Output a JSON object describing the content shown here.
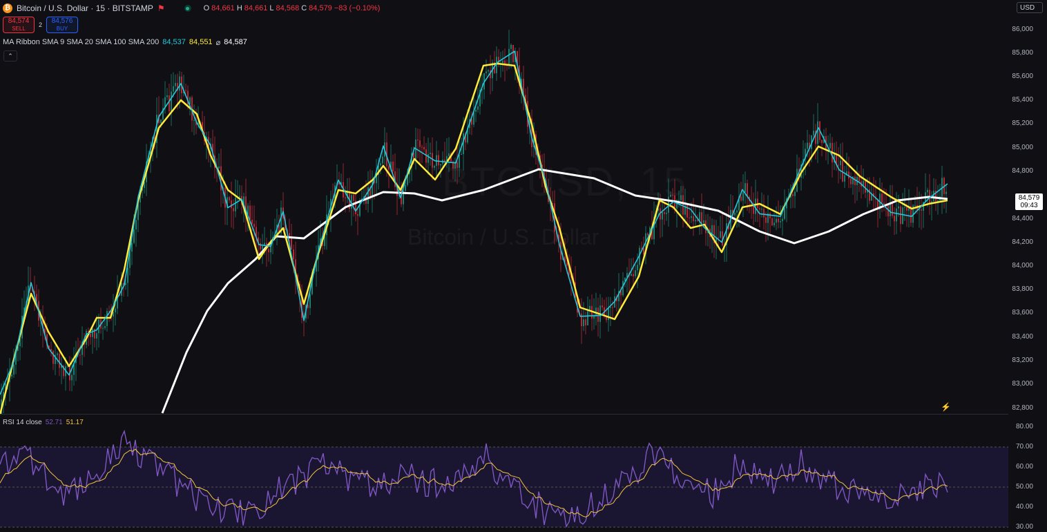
{
  "symbol": {
    "title": "Bitcoin / U.S. Dollar · 15 · BITSTAMP",
    "icon": "bitcoin-icon",
    "ohlc": [
      {
        "k": "O",
        "v": "84,661"
      },
      {
        "k": "H",
        "v": "84,661"
      },
      {
        "k": "L",
        "v": "84,568"
      },
      {
        "k": "C",
        "v": "84,579"
      },
      {
        "k": "",
        "v": "−83 (−0.10%)"
      }
    ]
  },
  "trade": {
    "sell_price": "84,574",
    "sell_label": "SELL",
    "buy_price": "84,576",
    "buy_label": "BUY",
    "spread": "2"
  },
  "ribbon": {
    "label": "MA Ribbon SMA 9 SMA 20 SMA 100 SMA 200",
    "v1": "84,537",
    "v2": "84,551",
    "sep": "⌀",
    "v3": "84,587"
  },
  "currency": "USD",
  "price_axis": [
    "86,000",
    "85,800",
    "85,600",
    "85,400",
    "85,200",
    "85,000",
    "84,800",
    "84,400",
    "84,200",
    "84,000",
    "83,800",
    "83,600",
    "83,400",
    "83,200",
    "83,000",
    "82,800"
  ],
  "last_price": {
    "price": "84,579",
    "countdown": "09:43"
  },
  "rsi": {
    "label": "RSI 14 close",
    "value": "52.71",
    "ma_value": "51.17",
    "axis": [
      "80.00",
      "70.00",
      "60.00",
      "50.00",
      "40.00",
      "30.00"
    ]
  },
  "watermark": {
    "big": "BTCUSD, 15",
    "small": "Bitcoin / U.S. Dollar"
  },
  "colors": {
    "bg": "#0f0f14",
    "up": "#22ab94",
    "down": "#f23645",
    "sma9": "#26c6da",
    "sma20": "#ffeb3b",
    "sma200": "#ffffff",
    "rsi": "#7e57c2",
    "rsi_ma": "#f5c542"
  }
}
